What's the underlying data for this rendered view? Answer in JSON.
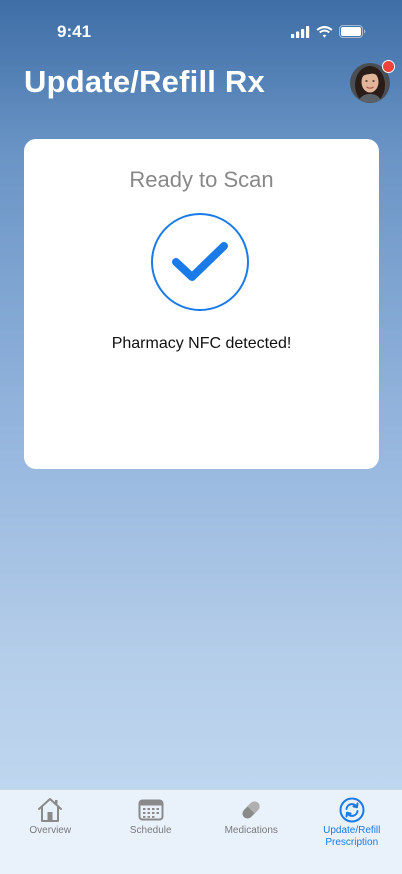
{
  "status_bar": {
    "time": "9:41",
    "icons": [
      "cellular-signal-icon",
      "wifi-icon",
      "battery-icon"
    ]
  },
  "header": {
    "title": "Update/Refill Rx",
    "avatar_notification": true
  },
  "scan_card": {
    "title": "Ready to Scan",
    "icon": "checkmark-icon",
    "message": "Pharmacy NFC detected!"
  },
  "tab_bar": {
    "active_tab": "Update/Refill Prescription",
    "tabs": [
      {
        "label": "Overview",
        "icon": "home-icon"
      },
      {
        "label": "Schedule",
        "icon": "calendar-icon"
      },
      {
        "label": "Medications",
        "icon": "pill-icon"
      },
      {
        "label": "Update/Refill\nPrescription",
        "icon": "refresh-icon"
      }
    ]
  },
  "colors": {
    "accent": "#1a7be8",
    "inactive_tab": "#7a7a7a",
    "notification": "#f0413b",
    "card_bg": "#ffffff"
  }
}
